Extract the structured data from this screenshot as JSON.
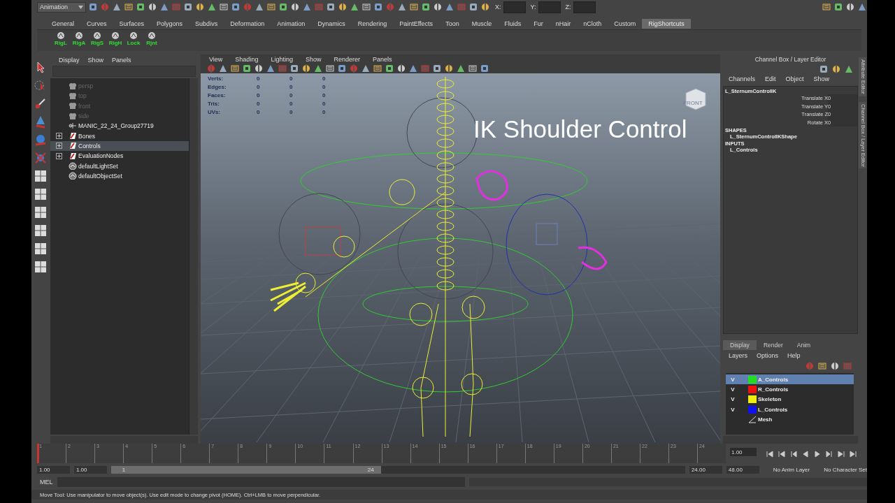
{
  "status_line": {
    "menu_set": "Animation",
    "fields": [
      {
        "label": "X:"
      },
      {
        "label": "Y:"
      },
      {
        "label": "Z:"
      }
    ]
  },
  "shelf": {
    "tabs": [
      {
        "label": "General",
        "selected": false
      },
      {
        "label": "Curves",
        "selected": false
      },
      {
        "label": "Surfaces",
        "selected": false
      },
      {
        "label": "Polygons",
        "selected": false
      },
      {
        "label": "Subdivs",
        "selected": false
      },
      {
        "label": "Deformation",
        "selected": false
      },
      {
        "label": "Animation",
        "selected": false
      },
      {
        "label": "Dynamics",
        "selected": false
      },
      {
        "label": "Rendering",
        "selected": false
      },
      {
        "label": "PaintEffects",
        "selected": false
      },
      {
        "label": "Toon",
        "selected": false
      },
      {
        "label": "Muscle",
        "selected": false
      },
      {
        "label": "Fluids",
        "selected": false
      },
      {
        "label": "Fur",
        "selected": false
      },
      {
        "label": "nHair",
        "selected": false
      },
      {
        "label": "nCloth",
        "selected": false
      },
      {
        "label": "Custom",
        "selected": false
      },
      {
        "label": "RigShortcuts",
        "selected": true
      }
    ],
    "buttons": [
      "RigL",
      "RigA",
      "RigS",
      "RigH",
      "Lock",
      "Rjnt"
    ]
  },
  "outliner": {
    "menus": [
      "Display",
      "Show",
      "Panels"
    ],
    "items": [
      {
        "label": "persp",
        "kind": "camera",
        "dimmed": true,
        "expandable": false,
        "selected": false
      },
      {
        "label": "top",
        "kind": "camera",
        "dimmed": true,
        "expandable": false,
        "selected": false
      },
      {
        "label": "front",
        "kind": "camera",
        "dimmed": true,
        "expandable": false,
        "selected": false
      },
      {
        "label": "side",
        "kind": "camera",
        "dimmed": true,
        "expandable": false,
        "selected": false
      },
      {
        "label": "MANIC_22_24_Group27719",
        "kind": "group",
        "dimmed": false,
        "expandable": false,
        "selected": false
      },
      {
        "label": "Bones",
        "kind": "layer",
        "dimmed": false,
        "expandable": true,
        "selected": false
      },
      {
        "label": "Controls",
        "kind": "layer",
        "dimmed": false,
        "expandable": true,
        "selected": true
      },
      {
        "label": "EvaluationNodes",
        "kind": "layer",
        "dimmed": false,
        "expandable": true,
        "selected": false
      },
      {
        "label": "defaultLightSet",
        "kind": "set",
        "dimmed": false,
        "expandable": false,
        "selected": false
      },
      {
        "label": "defaultObjectSet",
        "kind": "set",
        "dimmed": false,
        "expandable": false,
        "selected": false
      }
    ]
  },
  "viewport": {
    "menus": [
      "View",
      "Shading",
      "Lighting",
      "Show",
      "Renderer",
      "Panels"
    ],
    "hud": [
      {
        "label": "Verts:",
        "values": [
          "0",
          "0",
          "0"
        ]
      },
      {
        "label": "Edges:",
        "values": [
          "0",
          "0",
          "0"
        ]
      },
      {
        "label": "Faces:",
        "values": [
          "0",
          "0",
          "0"
        ]
      },
      {
        "label": "Tris:",
        "values": [
          "0",
          "0",
          "0"
        ]
      },
      {
        "label": "UVs:",
        "values": [
          "0",
          "0",
          "0"
        ]
      }
    ],
    "view_cube_label": "FRONT",
    "caption": "IK Shoulder Control"
  },
  "channel_box": {
    "title": "Channel Box / Layer Editor",
    "menus": [
      "Channels",
      "Edit",
      "Object",
      "Show"
    ],
    "object": "L_SternumControlIK",
    "channels": [
      {
        "name": "Translate X",
        "value": "0"
      },
      {
        "name": "Translate Y",
        "value": "0"
      },
      {
        "name": "Translate Z",
        "value": "0"
      },
      {
        "name": "Rotate X",
        "value": "0"
      }
    ],
    "shapes_heading": "SHAPES",
    "shapes": [
      "L_SternumControlIKShape"
    ],
    "inputs_heading": "INPUTS",
    "inputs": [
      "L_Controls"
    ],
    "side_tabs": [
      "Attribute Editor",
      "Channel Box / Layer Editor"
    ]
  },
  "layer_editor": {
    "tabs": [
      {
        "label": "Display",
        "selected": true
      },
      {
        "label": "Render",
        "selected": false
      },
      {
        "label": "Anim",
        "selected": false
      }
    ],
    "menus": [
      "Layers",
      "Options",
      "Help"
    ],
    "layers": [
      {
        "visibility": "V",
        "name": "A_Controls",
        "color": "#22dd22",
        "selected": true
      },
      {
        "visibility": "V",
        "name": "R_Controls",
        "color": "#ee1111",
        "selected": false
      },
      {
        "visibility": "V",
        "name": "Skeleton",
        "color": "#eeee11",
        "selected": false
      },
      {
        "visibility": "V",
        "name": "L_Controls",
        "color": "#1111ee",
        "selected": false
      },
      {
        "name": "Mesh",
        "selected": false
      }
    ]
  },
  "time_slider": {
    "ticks": [
      "1",
      "2",
      "3",
      "4",
      "5",
      "6",
      "7",
      "8",
      "9",
      "10",
      "11",
      "12",
      "13",
      "14",
      "15",
      "16",
      "17",
      "18",
      "19",
      "20",
      "21",
      "22",
      "23",
      "24"
    ],
    "current": "1.00",
    "level": 0
  },
  "range_slider": {
    "start": "1.00",
    "range_start": "1.00",
    "range_low": "1",
    "range_high": "24",
    "level": 0.47,
    "range_end": "24.00",
    "end": "48.00",
    "anim_layer": "No Anim Layer",
    "character_set": "No Character Set"
  },
  "command_line": {
    "label": "MEL"
  },
  "help_line": "Move Tool: Use manipulator to move object(s). Use edit mode to change pivot (HOME). Ctrl+LMB to move perpendicular."
}
